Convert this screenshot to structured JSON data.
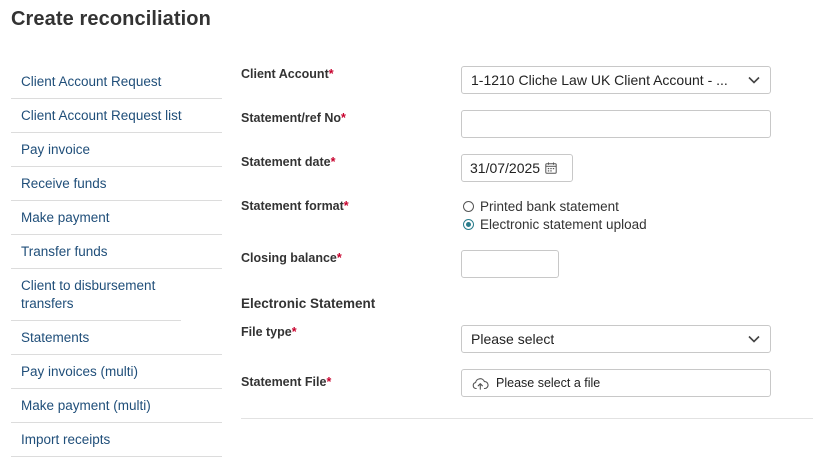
{
  "page": {
    "title": "Create reconciliation"
  },
  "sidebar": {
    "items": [
      {
        "label": "Client Account Request"
      },
      {
        "label": "Client Account Request list"
      },
      {
        "label": "Pay invoice"
      },
      {
        "label": "Receive funds"
      },
      {
        "label": "Make payment"
      },
      {
        "label": "Transfer funds"
      },
      {
        "label": "Client to disbursement transfers"
      },
      {
        "label": "Statements"
      },
      {
        "label": "Pay invoices (multi)"
      },
      {
        "label": "Make payment (multi)"
      },
      {
        "label": "Import receipts"
      }
    ]
  },
  "form": {
    "required_marker": "*",
    "client_account": {
      "label": "Client Account",
      "value": "1-1210 Cliche Law UK Client Account - ..."
    },
    "statement_ref": {
      "label": "Statement/ref No",
      "value": ""
    },
    "statement_date": {
      "label": "Statement date",
      "value": "31/07/2025",
      "icon": "calendar-icon"
    },
    "statement_format": {
      "label": "Statement format",
      "options": [
        {
          "label": "Printed bank statement",
          "selected": false
        },
        {
          "label": "Electronic statement upload",
          "selected": true
        }
      ]
    },
    "closing_balance": {
      "label": "Closing balance",
      "value": ""
    },
    "electronic_section": {
      "heading": "Electronic Statement"
    },
    "file_type": {
      "label": "File type",
      "value": "Please select"
    },
    "statement_file": {
      "label": "Statement File",
      "value": "Please select a file",
      "icon": "cloud-upload-icon"
    }
  },
  "colors": {
    "link": "#1f4e79",
    "required": "#c7002c",
    "radio_accent": "#2a7d8c",
    "border": "#c8c8c8"
  }
}
